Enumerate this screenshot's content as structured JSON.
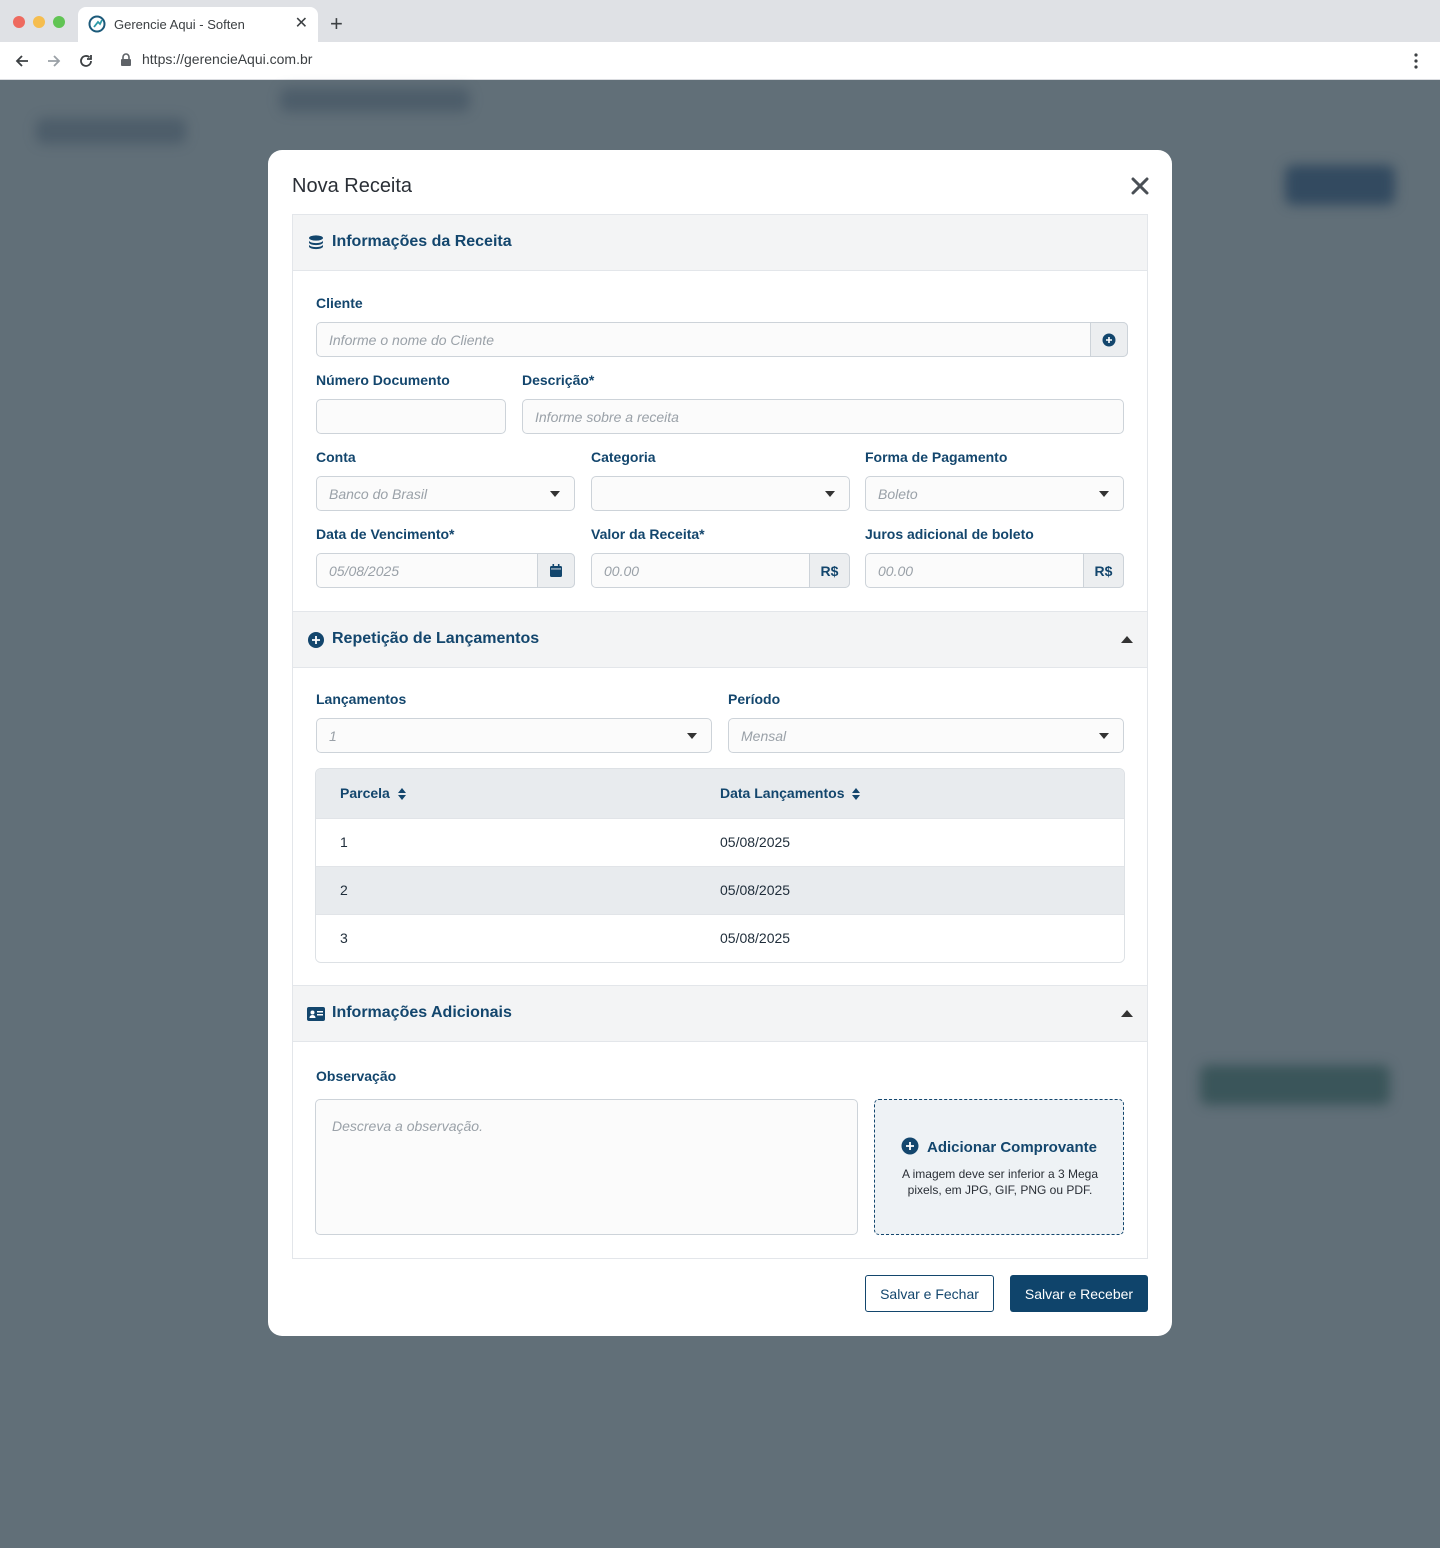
{
  "browser": {
    "tab_title": "Gerencie Aqui - Soften",
    "url": "https://gerencieAqui.com.br"
  },
  "modal": {
    "title": "Nova Receita",
    "info_section": {
      "title": "Informações da Receita",
      "cliente": {
        "label": "Cliente",
        "placeholder": "Informe o nome do Cliente"
      },
      "numero_documento": {
        "label": "Número Documento",
        "value": ""
      },
      "descricao": {
        "label": "Descrição*",
        "placeholder": "Informe sobre a receita"
      },
      "conta": {
        "label": "Conta",
        "value": "Banco do Brasil"
      },
      "categoria": {
        "label": "Categoria",
        "value": ""
      },
      "forma_pagamento": {
        "label": "Forma de Pagamento",
        "value": "Boleto"
      },
      "data_vencimento": {
        "label": "Data de Vencimento*",
        "value": "05/08/2025"
      },
      "valor_receita": {
        "label": "Valor da Receita*",
        "placeholder": "00.00",
        "currency": "R$"
      },
      "juros_boleto": {
        "label": "Juros adicional de boleto",
        "placeholder": "00.00",
        "currency": "R$"
      }
    },
    "repeticao_section": {
      "title": "Repetição de Lançamentos",
      "lancamentos": {
        "label": "Lançamentos",
        "value": "1"
      },
      "periodo": {
        "label": "Período",
        "value": "Mensal"
      },
      "table": {
        "headers": [
          "Parcela",
          "Data Lançamentos"
        ],
        "rows": [
          {
            "parcela": "1",
            "data": "05/08/2025"
          },
          {
            "parcela": "2",
            "data": "05/08/2025"
          },
          {
            "parcela": "3",
            "data": "05/08/2025"
          }
        ]
      }
    },
    "adicionais_section": {
      "title": "Informações Adicionais",
      "observacao": {
        "label": "Observação",
        "placeholder": "Descreva a observação."
      },
      "comprovante": {
        "title": "Adicionar Comprovante",
        "help": "A imagem deve ser inferior a 3 Mega pixels, em JPG, GIF, PNG ou PDF."
      }
    },
    "buttons": {
      "save_close": "Salvar e Fechar",
      "save_receive": "Salvar e Receber"
    }
  },
  "colors": {
    "brand": "#13466d",
    "primary_button": "#0f446b",
    "overlay": "#616f78"
  },
  "icons": [
    "coins-icon",
    "plus-circle-icon",
    "calendar-icon",
    "caret-down-icon",
    "caret-up-icon",
    "sort-icon",
    "id-card-icon",
    "close-icon"
  ]
}
